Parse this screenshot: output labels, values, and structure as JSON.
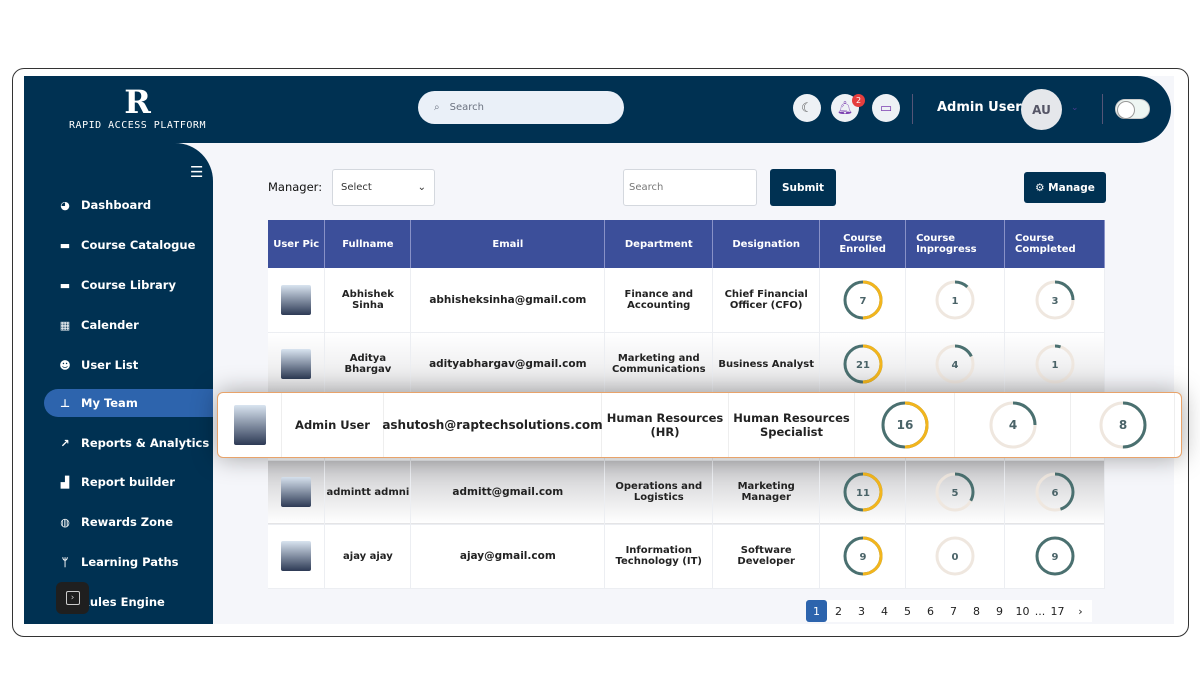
{
  "brand": {
    "name": "RAPID ACCESS PLATFORM",
    "logo_letter": "R"
  },
  "header": {
    "search_placeholder": "Search",
    "notification_count": "2",
    "user_name": "Admin User",
    "avatar_initials": "AU",
    "icons": [
      "moon-icon",
      "bell-icon",
      "chat-icon"
    ]
  },
  "sidebar": {
    "items": [
      {
        "label": "Dashboard",
        "icon": "gauge-icon",
        "glyph": "◕"
      },
      {
        "label": "Course Catalogue",
        "icon": "archive-icon",
        "glyph": "▬"
      },
      {
        "label": "Course Library",
        "icon": "archive-icon",
        "glyph": "▬"
      },
      {
        "label": "Calender",
        "icon": "calendar-icon",
        "glyph": "▦"
      },
      {
        "label": "User List",
        "icon": "users-icon",
        "glyph": "☻"
      },
      {
        "label": "My Team",
        "icon": "sitemap-icon",
        "glyph": "⊥",
        "active": true
      },
      {
        "label": "Reports & Analytics",
        "icon": "line-chart-icon",
        "glyph": "↗"
      },
      {
        "label": "Report builder",
        "icon": "area-chart-icon",
        "glyph": "▟"
      },
      {
        "label": "Rewards Zone",
        "icon": "gamepad-icon",
        "glyph": "◍"
      },
      {
        "label": "Learning Paths",
        "icon": "branch-icon",
        "glyph": "ᛘ"
      },
      {
        "label": "Rules Engine",
        "icon": "rules-icon",
        "glyph": "≡"
      }
    ]
  },
  "filters": {
    "manager_label": "Manager:",
    "manager_value": "Select",
    "search_placeholder": "Search",
    "submit_label": "Submit",
    "manage_label": "⚙ Manage"
  },
  "table": {
    "columns": [
      "User Pic",
      "Fullname",
      "Email",
      "Department",
      "Designation",
      "Course Enrolled",
      "Course Inprogress",
      "Course Completed"
    ],
    "rows": [
      {
        "name": "Abhishek Sinha",
        "email": "abhisheksinha@gmail.com",
        "department": "Finance and Accounting",
        "designation": "Chief Financial Officer (CFO)",
        "enrolled": 7,
        "inprogress": 1,
        "completed": 3,
        "inprogress_fill": 0.12,
        "completed_fill": 0.25
      },
      {
        "name": "Aditya Bhargav",
        "email": "adityabhargav@gmail.com",
        "department": "Marketing and Communications",
        "designation": "Business Analyst",
        "enrolled": 21,
        "inprogress": 4,
        "completed": 1,
        "inprogress_fill": 0.18,
        "completed_fill": 0.05
      },
      {
        "name": "admintt admni",
        "email": "admitt@gmail.com",
        "department": "Operations and Logistics",
        "designation": "Marketing Manager",
        "enrolled": 11,
        "inprogress": 5,
        "completed": 6,
        "inprogress_fill": 0.33,
        "completed_fill": 0.45
      },
      {
        "name": "ajay ajay",
        "email": "ajay@gmail.com",
        "department": "Information Technology (IT)",
        "designation": "Software Developer",
        "enrolled": 9,
        "inprogress": 0,
        "completed": 9,
        "inprogress_fill": 0,
        "completed_fill": 1
      }
    ],
    "highlighted": {
      "name": "Admin User",
      "email": "ashutosh@raptechsolutions.com",
      "department": "Human Resources (HR)",
      "designation": "Human Resources Specialist",
      "enrolled": 16,
      "inprogress": 4,
      "completed": 8,
      "inprogress_fill": 0.25,
      "completed_fill": 0.5
    }
  },
  "pagination": {
    "pages": [
      "1",
      "2",
      "3",
      "4",
      "5",
      "6",
      "7",
      "8",
      "9",
      "10",
      "...",
      "17",
      "›"
    ],
    "current": "1"
  },
  "colors": {
    "navy": "#003152",
    "accent": "#2d64ad",
    "table_header": "#3c4f9a",
    "ring_teal": "#4a7070",
    "ring_yellow": "#f2b51d",
    "ring_track": "#efe7df",
    "highlight_border": "#e8a36a"
  }
}
